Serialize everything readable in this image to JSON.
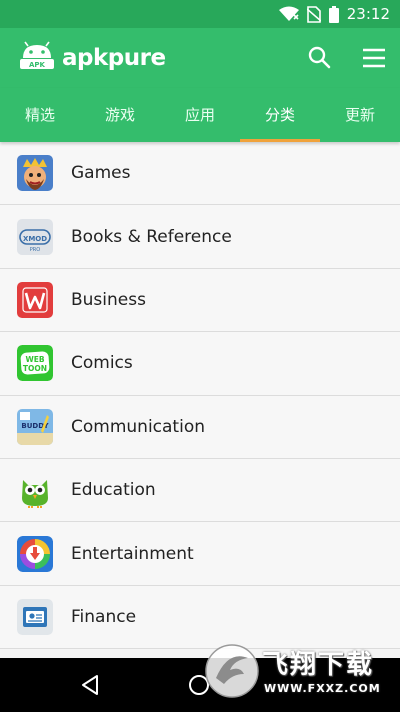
{
  "status": {
    "time": "23:12"
  },
  "app": {
    "brand": "apkpure",
    "logo_badge": "APK"
  },
  "tabs": [
    {
      "label": "精选"
    },
    {
      "label": "游戏"
    },
    {
      "label": "应用"
    },
    {
      "label": "分类",
      "active": true
    },
    {
      "label": "更新"
    }
  ],
  "categories": [
    {
      "label": "Games",
      "icon": "clash-royale-icon"
    },
    {
      "label": "Books & Reference",
      "icon": "xmod-pro-icon"
    },
    {
      "label": "Business",
      "icon": "wps-office-icon"
    },
    {
      "label": "Comics",
      "icon": "webtoon-icon"
    },
    {
      "label": "Communication",
      "icon": "buddy-icon"
    },
    {
      "label": "Education",
      "icon": "duolingo-owl-icon"
    },
    {
      "label": "Entertainment",
      "icon": "download-arrow-icon"
    },
    {
      "label": "Finance",
      "icon": "finance-card-icon"
    }
  ],
  "watermark": {
    "title": "飞翔下载",
    "url": "WWW.FXXZ.COM"
  },
  "colors": {
    "primary": "#34bd6c",
    "status_bar": "#28a85a",
    "tab_indicator": "#f0a23b"
  }
}
